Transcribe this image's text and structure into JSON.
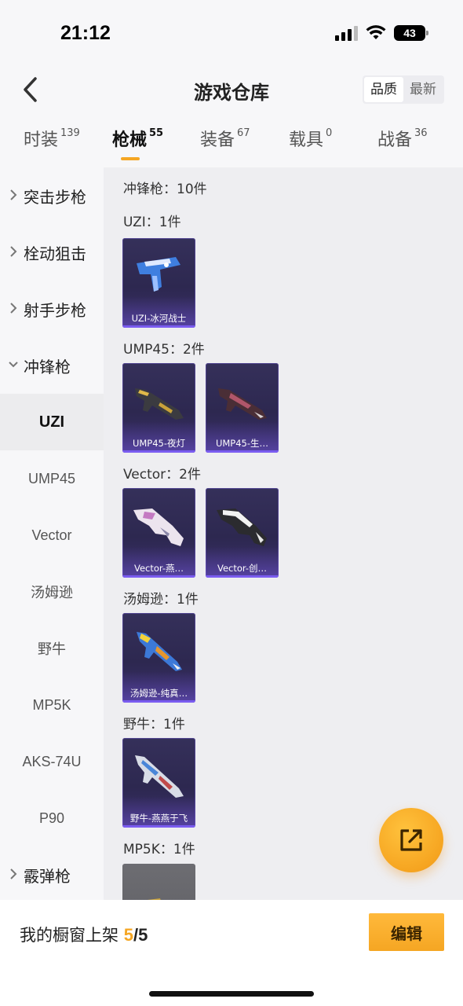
{
  "status_bar": {
    "time": "21:12",
    "battery": "43"
  },
  "header": {
    "title": "游戏仓库",
    "sort_options": [
      "品质",
      "最新"
    ],
    "active_sort": "品质"
  },
  "tabs": [
    {
      "label": "时装",
      "count": "139"
    },
    {
      "label": "枪械",
      "count": "55",
      "active": true
    },
    {
      "label": "装备",
      "count": "67"
    },
    {
      "label": "载具",
      "count": "0"
    },
    {
      "label": "战备",
      "count": "36"
    }
  ],
  "sidebar": {
    "groups": [
      {
        "label": "突击步枪",
        "expanded": false
      },
      {
        "label": "栓动狙击",
        "expanded": false
      },
      {
        "label": "射手步枪",
        "expanded": false
      },
      {
        "label": "冲锋枪",
        "expanded": true
      },
      {
        "label": "霰弹枪",
        "expanded": false
      }
    ],
    "subitems": [
      "UZI",
      "UMP45",
      "Vector",
      "汤姆逊",
      "野牛",
      "MP5K",
      "AKS-74U",
      "P90"
    ],
    "selected": "UZI"
  },
  "content": {
    "category_summary": "冲锋枪：10件",
    "sections": [
      {
        "label": "UZI：1件",
        "items": [
          "UZI-冰河战士"
        ]
      },
      {
        "label": "UMP45：2件",
        "items": [
          "UMP45-夜灯",
          "UMP45-生…"
        ]
      },
      {
        "label": "Vector：2件",
        "items": [
          "Vector-燕…",
          "Vector-创…"
        ]
      },
      {
        "label": "汤姆逊：1件",
        "items": [
          "汤姆逊-纯真…"
        ]
      },
      {
        "label": "野牛：1件",
        "items": [
          "野牛-燕燕于飞"
        ]
      },
      {
        "label": "MP5K：1件",
        "items": [
          ""
        ]
      }
    ]
  },
  "bottom_bar": {
    "label": "我的橱窗上架",
    "current": "5",
    "separator": "/",
    "total": "5",
    "edit_label": "编辑"
  },
  "colors": {
    "accent": "#f5a623",
    "card_purple": "#2d2850",
    "selected_bg": "#ececee"
  },
  "icons": {
    "back": "chevron-left-icon",
    "share": "external-link-icon",
    "group_collapsed": "chevron-right-icon",
    "group_expanded": "chevron-down-icon"
  }
}
